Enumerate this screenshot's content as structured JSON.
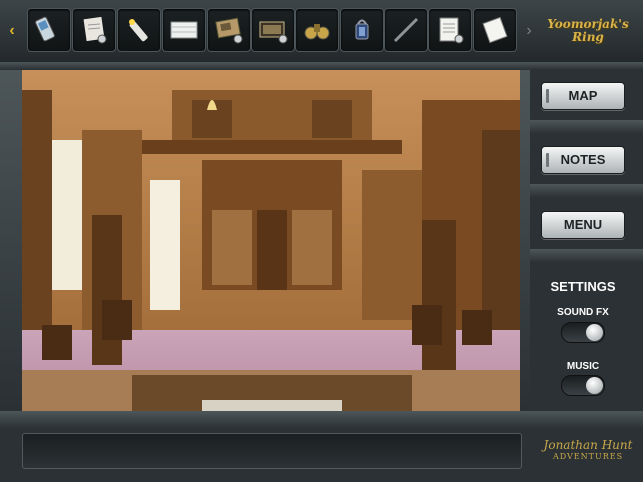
{
  "app": {
    "logo_line1": "Yoomorjak's",
    "logo_line2": "Ring"
  },
  "inventory": {
    "scroll_left_icon": "chevron-left-icon",
    "scroll_right_icon": "chevron-right-icon",
    "items": [
      {
        "name": "cell-phone",
        "icon": "phone-icon"
      },
      {
        "name": "paper-note",
        "icon": "paper-note-icon"
      },
      {
        "name": "flashlight",
        "icon": "flashlight-icon"
      },
      {
        "name": "blank-card",
        "icon": "card-icon"
      },
      {
        "name": "device",
        "icon": "device-icon"
      },
      {
        "name": "film-strip",
        "icon": "film-icon"
      },
      {
        "name": "binoculars",
        "icon": "binoculars-icon"
      },
      {
        "name": "lantern",
        "icon": "lantern-icon"
      },
      {
        "name": "rod",
        "icon": "rod-icon"
      },
      {
        "name": "notepad",
        "icon": "notepad-icon"
      },
      {
        "name": "paper-sheet",
        "icon": "paper-sheet-icon"
      }
    ]
  },
  "menu": {
    "map_label": "MAP",
    "notes_label": "NOTES",
    "menu_label": "MENU"
  },
  "settings": {
    "title": "SETTINGS",
    "sound_label": "SOUND FX",
    "sound_on": true,
    "music_label": "MUSIC",
    "music_on": true
  },
  "footer": {
    "brand_line1": "Jonathan Hunt",
    "brand_line2": "ADVENTURES",
    "message": ""
  },
  "colors": {
    "accent": "#e0b62a",
    "panel": "#2b3134",
    "button": "#d9dcdd"
  }
}
